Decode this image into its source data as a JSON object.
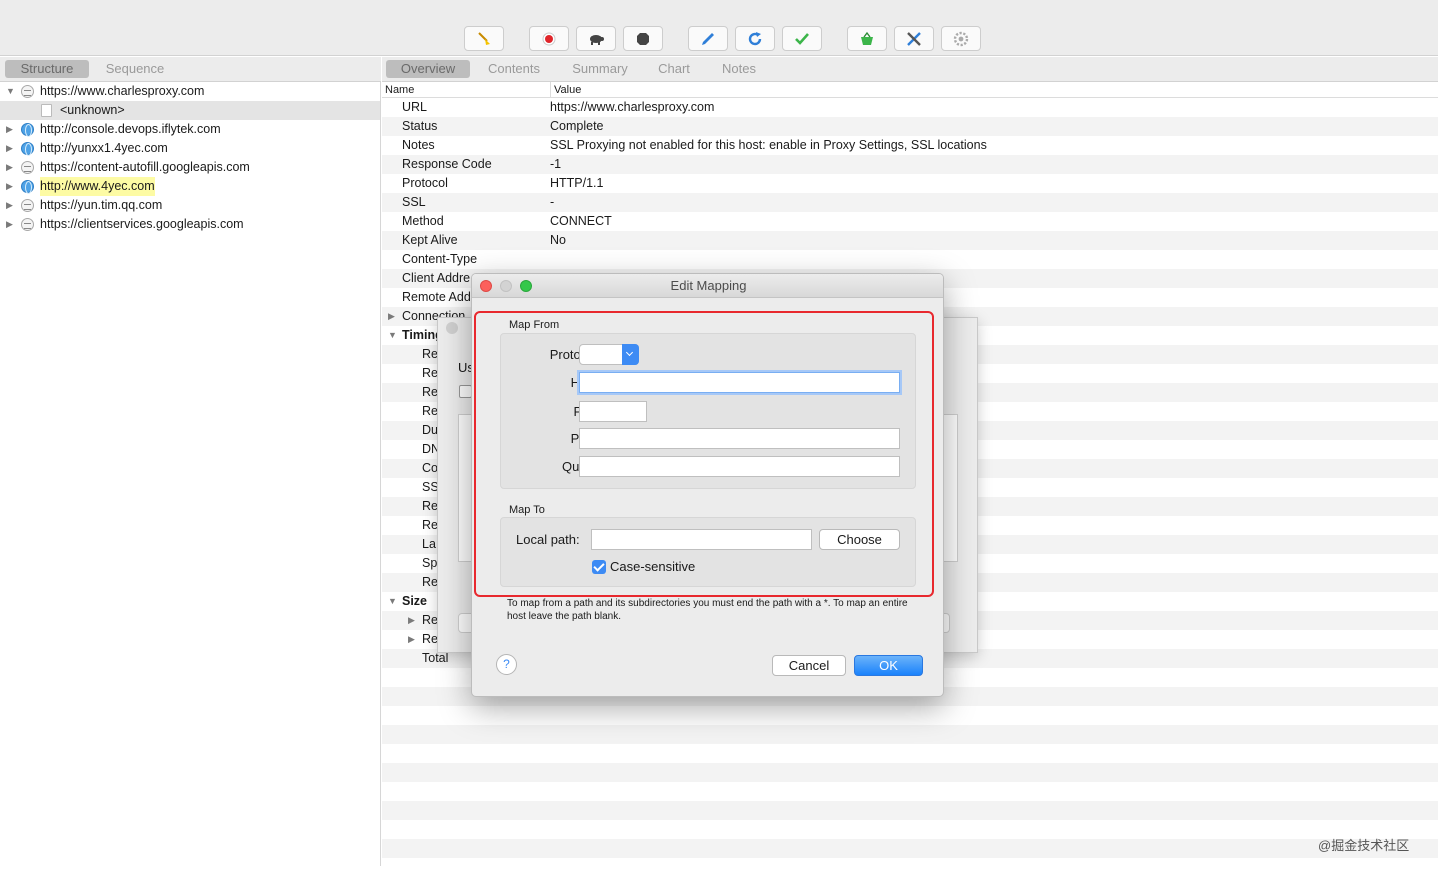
{
  "toolbar": {
    "buttons": [
      "broom-icon",
      "record-icon",
      "turtle-icon",
      "stop-icon",
      "pen-icon",
      "refresh-icon",
      "check-icon",
      "basket-icon",
      "tools-icon",
      "gear-icon"
    ]
  },
  "left_tabs": {
    "structure": "Structure",
    "sequence": "Sequence"
  },
  "tree": [
    {
      "label": "https://www.charlesproxy.com",
      "icon": "lock",
      "expanded": true
    },
    {
      "label": "<unknown>",
      "icon": "doc",
      "child": true
    },
    {
      "label": "http://console.devops.iflytek.com",
      "icon": "globe"
    },
    {
      "label": "http://yunxx1.4yec.com",
      "icon": "globe"
    },
    {
      "label": "https://content-autofill.googleapis.com",
      "icon": "lock"
    },
    {
      "label": "http://www.4yec.com",
      "icon": "globe",
      "highlight": true
    },
    {
      "label": "https://yun.tim.qq.com",
      "icon": "lock"
    },
    {
      "label": "https://clientservices.googleapis.com",
      "icon": "lock"
    }
  ],
  "right_tabs": {
    "overview": "Overview",
    "contents": "Contents",
    "summary": "Summary",
    "chart": "Chart",
    "notes": "Notes"
  },
  "table_header": {
    "name": "Name",
    "value": "Value"
  },
  "overview_rows": [
    {
      "name": "URL",
      "value": "https://www.charlesproxy.com"
    },
    {
      "name": "Status",
      "value": "Complete"
    },
    {
      "name": "Notes",
      "value": "SSL Proxying not enabled for this host: enable in Proxy Settings, SSL locations"
    },
    {
      "name": "Response Code",
      "value": "-1"
    },
    {
      "name": "Protocol",
      "value": "HTTP/1.1"
    },
    {
      "name": "SSL",
      "value": "-"
    },
    {
      "name": "Method",
      "value": "CONNECT"
    },
    {
      "name": "Kept Alive",
      "value": "No"
    },
    {
      "name": "Content-Type",
      "value": ""
    },
    {
      "name": "Client Addre",
      "value": ""
    },
    {
      "name": "Remote Add",
      "value": ""
    },
    {
      "name": "Connection",
      "value": ""
    },
    {
      "name": "Timing",
      "value": ""
    }
  ],
  "timing_children": [
    "Re",
    "Re",
    "Re",
    "Re",
    "Du",
    "DN",
    "Co",
    "SS",
    "Re",
    "Re",
    "La",
    "Sp",
    "Re"
  ],
  "size_section": {
    "label": "Size",
    "children": [
      "Re",
      "Re"
    ],
    "total": "Total"
  },
  "bg_sheet": {
    "label": "Us"
  },
  "dialog": {
    "title": "Edit Mapping",
    "map_from": "Map From",
    "protocol_label": "Protocol:",
    "host_label": "Host:",
    "port_label": "Port:",
    "path_label": "Path:",
    "query_label": "Query:",
    "map_to": "Map To",
    "local_path_label": "Local path:",
    "choose": "Choose",
    "case_sensitive": "Case-sensitive",
    "hint": "To map from a path and its subdirectories you must end the path with a *. To map an entire host leave the path blank.",
    "help": "?",
    "cancel": "Cancel",
    "ok": "OK"
  },
  "watermark": "@掘金技术社区",
  "colors": {
    "highlight_box": "#e8282e",
    "accent": "#3d8bf4"
  }
}
